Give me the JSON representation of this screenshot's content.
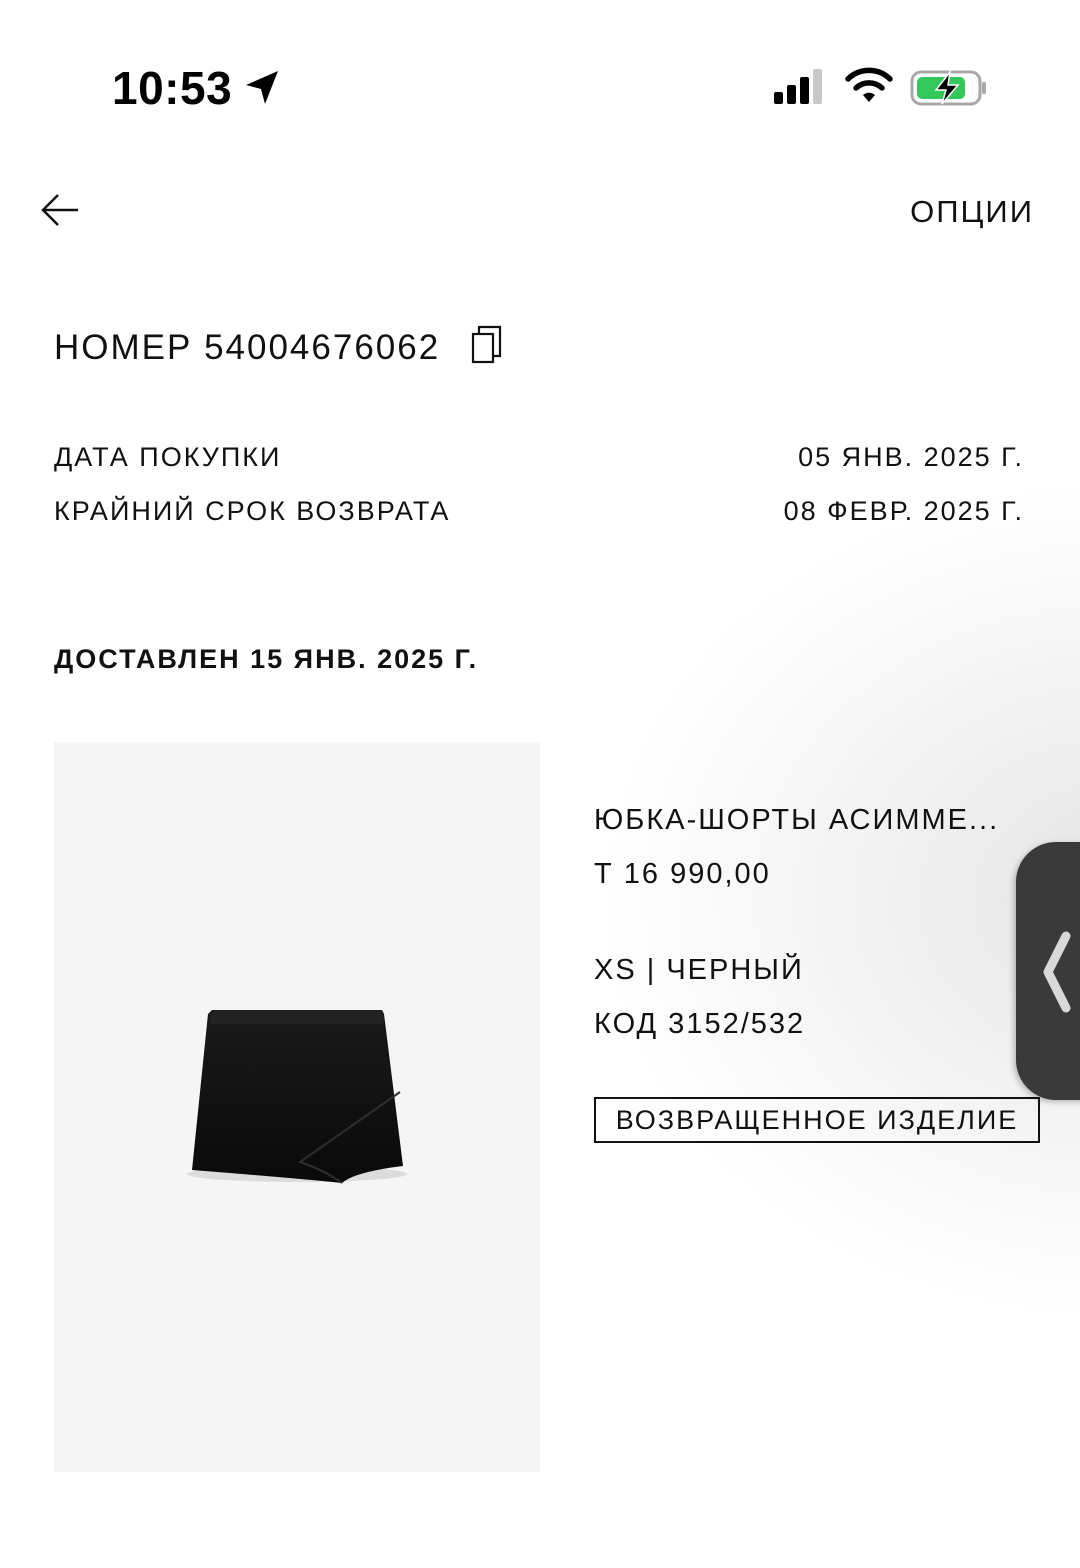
{
  "status_bar": {
    "time": "10:53",
    "icons": [
      "location-arrow-icon",
      "cellular-signal-icon",
      "wifi-icon",
      "battery-charging-icon"
    ],
    "battery_color": "#34c759"
  },
  "header": {
    "back_icon": "arrow-left-icon",
    "options_label": "ОПЦИИ"
  },
  "order": {
    "number_label": "НОМЕР 54004676062",
    "copy_icon": "copy-icon"
  },
  "info": {
    "purchase_date_label": "ДАТА ПОКУПКИ",
    "purchase_date_value": "05 ЯНВ. 2025 Г.",
    "return_deadline_label": "КРАЙНИЙ СРОК ВОЗВРАТА",
    "return_deadline_value": "08 ФЕВР. 2025 Г."
  },
  "delivery": {
    "heading": "ДОСТАВЛЕН 15 ЯНВ. 2025 Г."
  },
  "product": {
    "name": "ЮБКА-ШОРТЫ АСИММЕ...",
    "price": "Т 16 990,00",
    "variant": "XS | ЧЕРНЫЙ",
    "code": "КОД 3152/532",
    "status_badge": "ВОЗВРАЩЕННОЕ ИЗДЕЛИЕ",
    "image_icon": "skirt-image"
  },
  "side_handle": {
    "icon": "chevron-left-icon"
  }
}
